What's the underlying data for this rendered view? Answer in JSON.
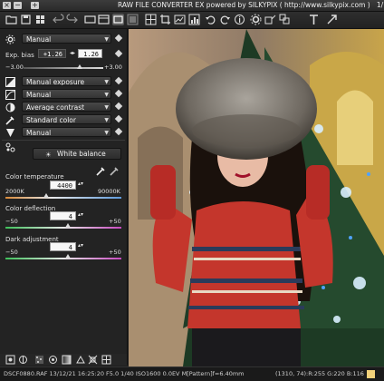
{
  "window": {
    "title": "RAW FILE CONVERTER EX powered by SILKYPIX ( http://www.silkypix.com )",
    "page_indicator": "1/1",
    "controls": [
      "close",
      "minimize",
      "zoom"
    ]
  },
  "toolbar": {
    "icons": [
      "open-folder-icon",
      "save-icon",
      "grid-view-icon",
      "undo-icon",
      "redo-icon",
      "single-view-icon",
      "filmstrip-view-icon",
      "compare-view-icon",
      "zoom-fit-icon",
      "layout-grid-icon",
      "crop-icon",
      "adjust-icon",
      "histogram-icon",
      "rotate-left-icon",
      "rotate-right-icon",
      "info-icon",
      "settings-icon",
      "develop-icon",
      "batch-icon",
      "tools-icon",
      "export-icon"
    ]
  },
  "exposure": {
    "preset": "Manual",
    "bias_label": "Exp. bias",
    "bias_value": "+1.26",
    "bias_field": "1.26",
    "range_min": "−3.00",
    "range_max": "+3.00",
    "bias_level": 0.71
  },
  "tone_settings": {
    "exposure_mode": "Manual exposure",
    "dynamic_range": "Manual",
    "contrast": "Average contrast",
    "color": "Standard color",
    "sharpness": "Manual"
  },
  "white_balance": {
    "button_label": "White balance",
    "color_temperature": {
      "label": "Color temperature",
      "value": "4400",
      "min": "2000K",
      "max": "90000K",
      "level": 0.35
    },
    "color_deflection": {
      "label": "Color deflection",
      "value": "4",
      "min": "−50",
      "max": "+50",
      "level": 0.54
    },
    "dark_adjustment": {
      "label": "Dark adjustment",
      "value": "4",
      "min": "−50",
      "max": "+50",
      "level": 0.54
    }
  },
  "colors": {
    "accent_warm": "#d88a3a",
    "accent_cool": "#5f9bdc",
    "deflection_green": "#3ec05a",
    "deflection_magenta": "#c84ac0",
    "swatch": "#f3d17a"
  },
  "status": {
    "file_info": "DSCF0880.RAF 13/12/21 16:25:20 F5.0 1/40 ISO1600 0.0EV M[Pattern]f=6.40mm",
    "pixel_info": "(1310,  74):R:255 G:220 B:116"
  }
}
